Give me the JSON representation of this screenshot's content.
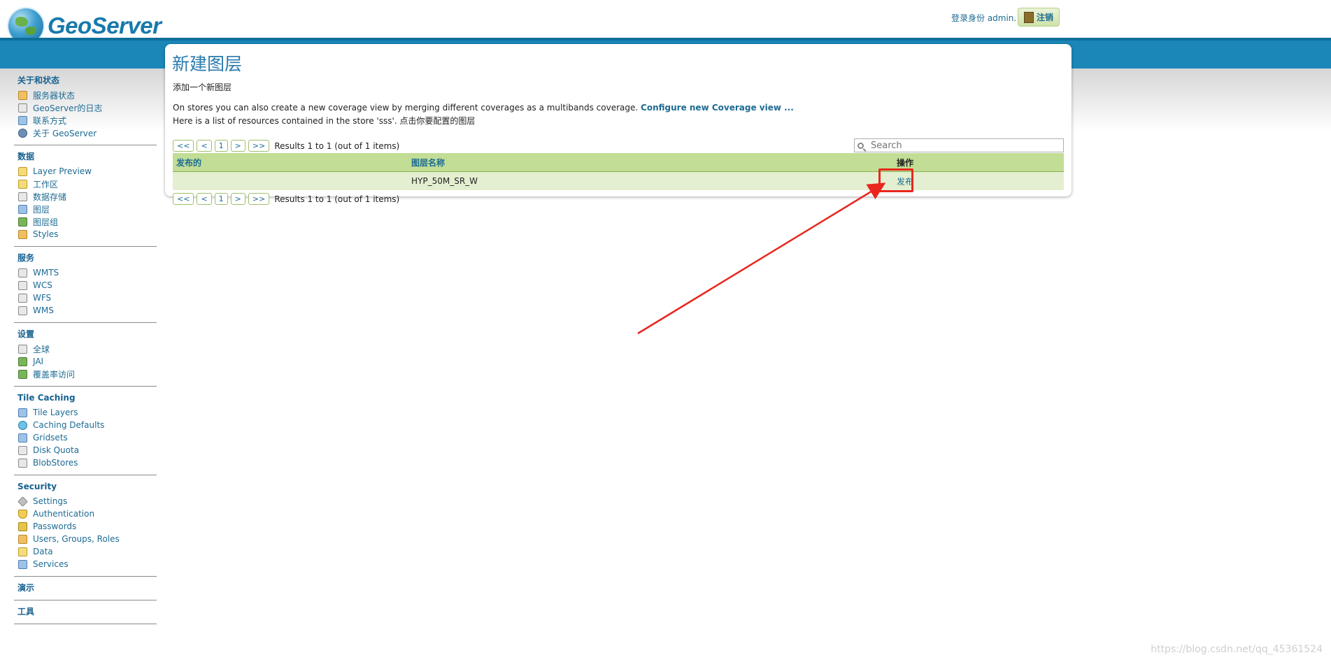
{
  "header": {
    "logo_text": "GeoServer",
    "login_text": "登录身份 admin.",
    "logout_label": "注销"
  },
  "sidebar": {
    "sections": [
      {
        "title": "关于和状态",
        "items": [
          {
            "label": "服务器状态",
            "icon": "server-status-icon"
          },
          {
            "label": "GeoServer的日志",
            "icon": "log-icon"
          },
          {
            "label": "联系方式",
            "icon": "contact-icon"
          },
          {
            "label": "关于 GeoServer",
            "icon": "about-icon"
          }
        ]
      },
      {
        "title": "数据",
        "items": [
          {
            "label": "Layer Preview",
            "icon": "layer-preview-icon"
          },
          {
            "label": "工作区",
            "icon": "workspace-folder-icon"
          },
          {
            "label": "数据存储",
            "icon": "datastore-icon"
          },
          {
            "label": "图层",
            "icon": "layer-icon"
          },
          {
            "label": "图层组",
            "icon": "layergroup-icon"
          },
          {
            "label": "Styles",
            "icon": "styles-icon"
          }
        ]
      },
      {
        "title": "服务",
        "items": [
          {
            "label": "WMTS",
            "icon": "service-icon"
          },
          {
            "label": "WCS",
            "icon": "service-icon"
          },
          {
            "label": "WFS",
            "icon": "service-icon"
          },
          {
            "label": "WMS",
            "icon": "service-icon"
          }
        ]
      },
      {
        "title": "设置",
        "items": [
          {
            "label": "全球",
            "icon": "global-settings-icon"
          },
          {
            "label": "JAI",
            "icon": "jai-icon"
          },
          {
            "label": "覆盖率访问",
            "icon": "coverage-access-icon"
          }
        ]
      },
      {
        "title": "Tile Caching",
        "items": [
          {
            "label": "Tile Layers",
            "icon": "tile-layers-icon"
          },
          {
            "label": "Caching Defaults",
            "icon": "caching-defaults-icon"
          },
          {
            "label": "Gridsets",
            "icon": "gridsets-icon"
          },
          {
            "label": "Disk Quota",
            "icon": "disk-quota-icon"
          },
          {
            "label": "BlobStores",
            "icon": "blobstores-icon"
          }
        ]
      },
      {
        "title": "Security",
        "items": [
          {
            "label": "Settings",
            "icon": "security-settings-icon"
          },
          {
            "label": "Authentication",
            "icon": "authentication-icon"
          },
          {
            "label": "Passwords",
            "icon": "passwords-icon"
          },
          {
            "label": "Users, Groups, Roles",
            "icon": "users-icon"
          },
          {
            "label": "Data",
            "icon": "data-security-icon"
          },
          {
            "label": "Services",
            "icon": "services-security-icon"
          }
        ]
      },
      {
        "title": "演示",
        "items": []
      },
      {
        "title": "工具",
        "items": []
      }
    ]
  },
  "main": {
    "title": "新建图层",
    "subtitle": "添加一个新图层",
    "desc_prefix": "On stores you can also create a new coverage view by merging different coverages as a multibands coverage.",
    "desc_link": "Configure new Coverage view ...",
    "desc2": "Here is a list of resources contained in the store 'sss'. 点击你要配置的图层",
    "pager": {
      "first": "<<",
      "prev": "<",
      "page": "1",
      "next": ">",
      "last": ">>",
      "results": "Results 1 to 1 (out of 1 items)"
    },
    "search_placeholder": "Search",
    "table": {
      "headers": [
        "发布的",
        "图层名称",
        "操作"
      ],
      "rows": [
        {
          "published": "",
          "name": "HYP_50M_SR_W",
          "action": "发布"
        }
      ]
    }
  },
  "annotation": {
    "color": "#e8261d"
  },
  "watermark": "https://blog.csdn.net/qq_45361524"
}
